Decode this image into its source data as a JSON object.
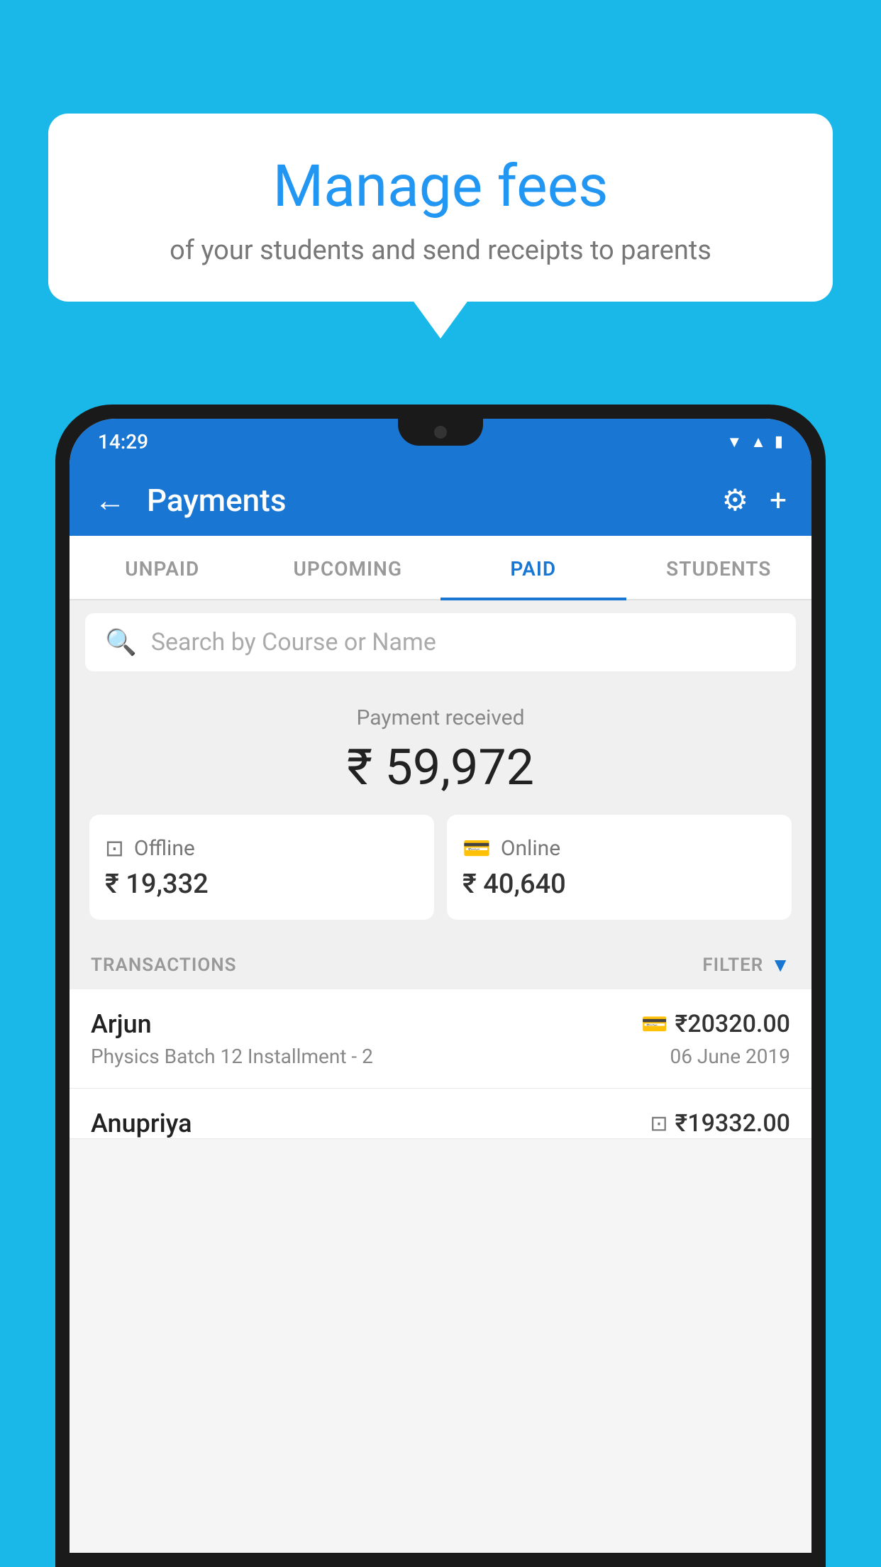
{
  "background_color": "#1ab8e8",
  "speech_bubble": {
    "title": "Manage fees",
    "subtitle": "of your students and send receipts to parents"
  },
  "phone": {
    "status_bar": {
      "time": "14:29",
      "icons": [
        "wifi",
        "signal",
        "battery"
      ]
    },
    "app_bar": {
      "title": "Payments",
      "back_label": "←",
      "settings_icon": "⚙",
      "add_icon": "+"
    },
    "tabs": [
      {
        "label": "UNPAID",
        "active": false
      },
      {
        "label": "UPCOMING",
        "active": false
      },
      {
        "label": "PAID",
        "active": true
      },
      {
        "label": "STUDENTS",
        "active": false
      }
    ],
    "search": {
      "placeholder": "Search by Course or Name"
    },
    "payment_summary": {
      "label": "Payment received",
      "amount": "₹ 59,972",
      "offline": {
        "type": "Offline",
        "amount": "₹ 19,332"
      },
      "online": {
        "type": "Online",
        "amount": "₹ 40,640"
      }
    },
    "transactions": {
      "label": "TRANSACTIONS",
      "filter_label": "FILTER",
      "rows": [
        {
          "name": "Arjun",
          "course": "Physics Batch 12 Installment - 2",
          "amount": "₹20320.00",
          "date": "06 June 2019",
          "payment_type": "card"
        },
        {
          "name": "Anupriya",
          "amount": "₹19332.00",
          "payment_type": "cash"
        }
      ]
    }
  }
}
